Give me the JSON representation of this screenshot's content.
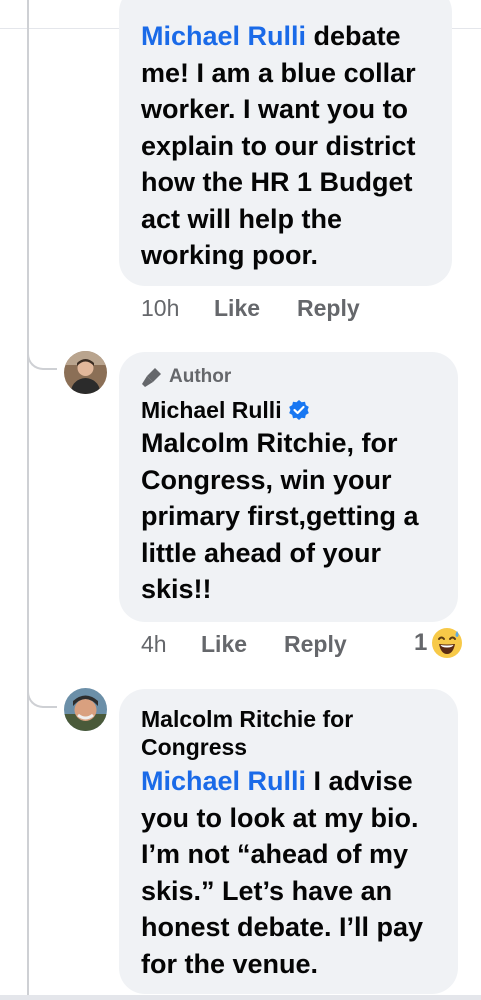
{
  "comments": [
    {
      "mention": "Michael Rulli",
      "text": " debate me!  I am a blue collar worker. I want you to explain to our district how the HR 1 Budget act will help the working poor.",
      "time": "10h",
      "like": "Like",
      "reply": "Reply"
    },
    {
      "badge": "Author",
      "author": "Michael Rulli",
      "verified": true,
      "text": "Malcolm Ritchie, for Congress, win your primary first,getting a little ahead of your skis!!",
      "time": "4h",
      "like": "Like",
      "reply": "Reply",
      "reaction_count": "1",
      "reaction_icon": "grinning-sweat-emoji"
    },
    {
      "author": "Malcolm Ritchie for Congress",
      "mention": "Michael Rulli",
      "text": " I advise you to look at my bio. I’m not “ahead of my skis.” Let’s have an honest debate. I’ll pay for the venue."
    }
  ],
  "colors": {
    "bubble": "#f0f2f5",
    "mention": "#1a6ae8",
    "muted": "#65676b",
    "verified": "#1877f2"
  }
}
